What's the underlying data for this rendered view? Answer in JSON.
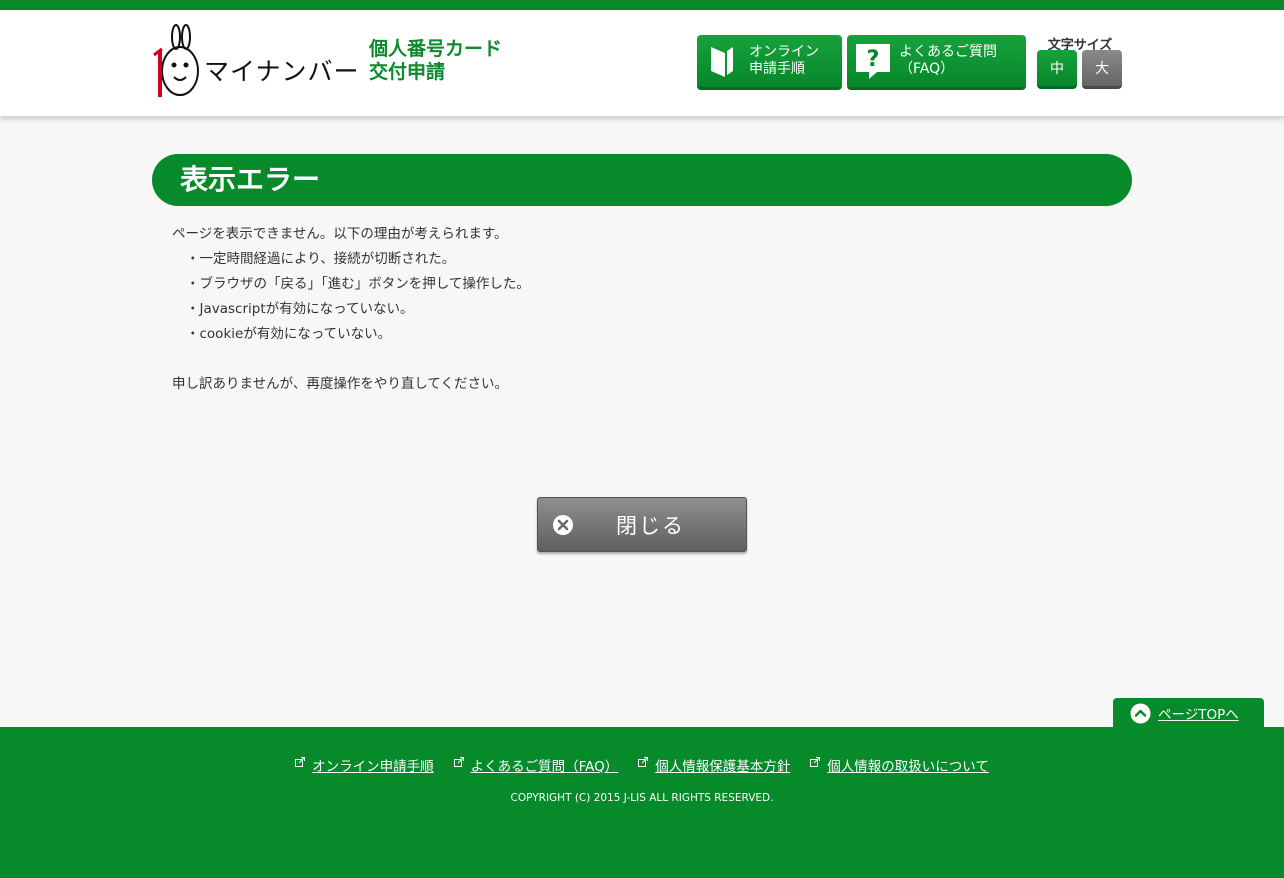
{
  "header": {
    "logo_text": "マイナンバー",
    "subtitle_line1": "個人番号カード",
    "subtitle_line2": "交付申請",
    "online_button": {
      "line1": "オンライン",
      "line2": "申請手順",
      "icon": "book-icon"
    },
    "faq_button": {
      "line1": "よくあるご質問",
      "line2": "（FAQ）",
      "icon": "question-icon"
    },
    "font_size": {
      "label": "文字サイズ",
      "medium": "中",
      "large": "大"
    }
  },
  "main": {
    "title": "表示エラー",
    "message": "ページを表示できません。以下の理由が考えられます。",
    "reasons": [
      "・一定時間経過により、接続が切断された。",
      "・ブラウザの「戻る」「進む」ボタンを押して操作した。",
      "・Javascriptが有効になっていない。",
      "・cookieが有効になっていない。"
    ],
    "apology": "申し訳ありませんが、再度操作をやり直してください。",
    "close_button": "閉じる"
  },
  "page_top": "ページTOPへ",
  "footer": {
    "links": [
      "オンライン申請手順",
      "よくあるご質問（FAQ）",
      "個人情報保護基本方針",
      "個人情報の取扱いについて"
    ],
    "copyright": "COPYRIGHT (C) 2015 J-LIS ALL RIGHTS RESERVED."
  },
  "colors": {
    "brand_green": "#068a2a",
    "button_gray": "#6f6f6f",
    "background": "#f7f7f7"
  }
}
